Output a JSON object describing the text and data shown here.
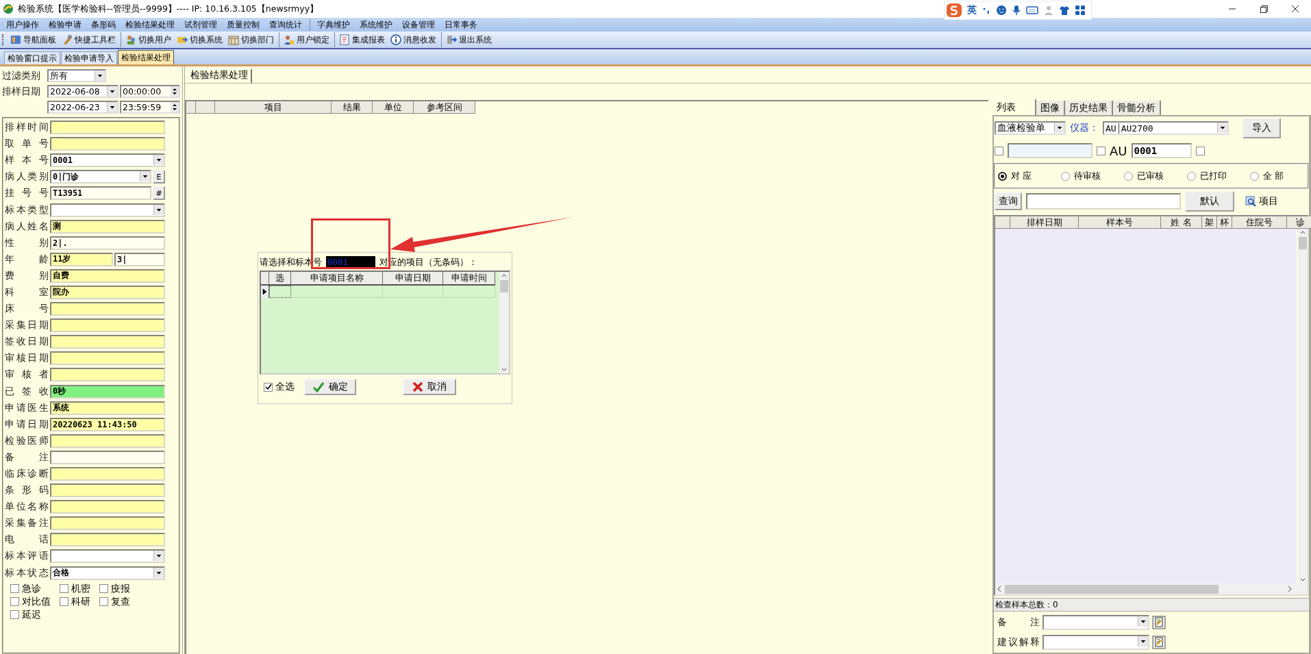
{
  "window": {
    "title": "检验系统【医学检验科--管理员--9999】---- IP: 10.16.3.105【newsrmyy】"
  },
  "ime_toolbar": {
    "mode": "英"
  },
  "menu": [
    {
      "label": "用户操作",
      "separator_before": false
    },
    {
      "label": "检验申请",
      "separator_before": false
    },
    {
      "label": "条形码",
      "separator_before": false
    },
    {
      "label": "检验结果处理",
      "separator_before": false
    },
    {
      "label": "试剂管理",
      "separator_before": false
    },
    {
      "label": "质量控制",
      "separator_before": false
    },
    {
      "label": "查询统计",
      "separator_before": false
    },
    {
      "label": "字典维护",
      "separator_before": true
    },
    {
      "label": "系统维护",
      "separator_before": false
    },
    {
      "label": "设备管理",
      "separator_before": false
    },
    {
      "label": "日常事务",
      "separator_before": false
    }
  ],
  "toolbar": [
    {
      "label": "导航面板",
      "separator_before": false
    },
    {
      "label": "快捷工具栏",
      "separator_before": false
    },
    {
      "label": "切换用户",
      "separator_before": true
    },
    {
      "label": "切换系统",
      "separator_before": false
    },
    {
      "label": "切换部门",
      "separator_before": false
    },
    {
      "label": "用户锁定",
      "separator_before": true
    },
    {
      "label": "集成报表",
      "separator_before": true
    },
    {
      "label": "消息收发",
      "separator_before": false
    },
    {
      "label": "退出系统",
      "separator_before": true
    }
  ],
  "page_tabs": [
    {
      "label": "检验窗口提示",
      "selected": false
    },
    {
      "label": "检验申请导入",
      "selected": false
    },
    {
      "label": "检验结果处理",
      "selected": true
    }
  ],
  "filter": {
    "category_label": "过滤类别",
    "category": "所有",
    "date_label": "排样日期",
    "from_date": "2022-06-08",
    "from_time": "00:00:00",
    "to_date": "2022-06-23",
    "to_time": "23:59:59"
  },
  "form_fields": [
    {
      "label": "排样时间",
      "kind": "text",
      "color": "#ffffa8"
    },
    {
      "label": "取 单 号",
      "kind": "text",
      "color": "#ffffa8"
    },
    {
      "label": "样 本 号",
      "kind": "select",
      "value": "0001",
      "color": "#ffffff"
    },
    {
      "label": "病人类别",
      "kind": "select_button",
      "value": "0|门诊",
      "button": "E",
      "color": "#ffffff"
    },
    {
      "label": "挂 号 号",
      "kind": "text_button",
      "value": "T13951",
      "button": "#",
      "color": "#fffff0"
    },
    {
      "label": "标本类型",
      "kind": "select",
      "color": "#ffffff"
    },
    {
      "label": "病人姓名",
      "kind": "text",
      "value": "测",
      "color": "#ffffa8"
    },
    {
      "label": "性 别",
      "kind": "text",
      "value": "2|.",
      "color": "#fffff0"
    },
    {
      "label": "年 龄",
      "kind": "pair",
      "value": "11岁",
      "value2": "3|",
      "color": "#ffffa8"
    },
    {
      "label": "费 别",
      "kind": "text",
      "value": "自费",
      "color": "#ffffa8"
    },
    {
      "label": "科 室",
      "kind": "text",
      "value": "院办",
      "color": "#ffffa8"
    },
    {
      "label": "床 号",
      "kind": "text",
      "color": "#ffffa8"
    },
    {
      "label": "采集日期",
      "kind": "text",
      "color": "#ffffa8"
    },
    {
      "label": "签收日期",
      "kind": "text",
      "color": "#ffffa8"
    },
    {
      "label": "审核日期",
      "kind": "text",
      "color": "#ffffa8"
    },
    {
      "label": "审 核 者",
      "kind": "text",
      "color": "#ffffa8"
    },
    {
      "label": "已 签 收",
      "kind": "text",
      "value": "0秒",
      "color": "#80f080"
    },
    {
      "label": "申请医生",
      "kind": "text",
      "value": "系统",
      "color": "#ffffa8"
    },
    {
      "label": "申请日期",
      "kind": "text",
      "value": "20220623 11:43:50",
      "color": "#ffffa8"
    },
    {
      "label": "检验医师",
      "kind": "text",
      "color": "#ffffa8"
    },
    {
      "label": "备 注",
      "kind": "text",
      "color": "#fffff0"
    },
    {
      "label": "临床诊断",
      "kind": "text",
      "color": "#ffffa8"
    },
    {
      "label": "条 形 码",
      "kind": "text",
      "color": "#ffffa8"
    },
    {
      "label": "单位名称",
      "kind": "text",
      "color": "#ffffa8"
    },
    {
      "label": "采集备注",
      "kind": "text",
      "color": "#ffffa8"
    },
    {
      "label": "电 话",
      "kind": "text",
      "color": "#ffffa8"
    },
    {
      "label": "标本评语",
      "kind": "select",
      "color": "#ffffff"
    },
    {
      "label": "标本状态",
      "kind": "select",
      "value": "合格",
      "color": "#ffffff"
    }
  ],
  "flags": [
    {
      "label": "急诊",
      "checked": false
    },
    {
      "label": "机密",
      "checked": false
    },
    {
      "label": "疫报",
      "checked": false
    },
    {
      "label": "对比值",
      "checked": false
    },
    {
      "label": "科研",
      "checked": false
    },
    {
      "label": "复查",
      "checked": false
    },
    {
      "label": "延迟",
      "checked": false
    }
  ],
  "center_tab": {
    "label": "检验结果处理"
  },
  "result_grid": {
    "columns": [
      "项目",
      "结果",
      "单位",
      "参考区间"
    ]
  },
  "dialog": {
    "prompt_before": "请选择和标本号",
    "sample_no": "0001",
    "prompt_after": "对应的项目（无条码）：",
    "columns": [
      "选",
      "申请项目名称",
      "申请日期",
      "申请时间"
    ],
    "select_all": {
      "label": "全选",
      "checked": true
    },
    "buttons": [
      {
        "label": "确定",
        "kind": "ok"
      },
      {
        "label": "取消",
        "kind": "cancel"
      }
    ]
  },
  "right_panel": {
    "tabs": [
      {
        "label": "列表",
        "selected": true
      },
      {
        "label": "图像",
        "selected": false
      },
      {
        "label": "历史结果",
        "selected": false
      },
      {
        "label": "骨髓分析",
        "selected": false
      }
    ],
    "sheet_type": "血液检验单",
    "instrument_label": "仪器：",
    "instrument_code": "AU",
    "instrument_name": "AU2700",
    "import_button": "导入",
    "check_a": false,
    "check_b": false,
    "au_label": "AU",
    "sample_no": "0001",
    "check_c": false,
    "radios": [
      {
        "label": "对 应",
        "selected": true
      },
      {
        "label": "待审核",
        "selected": false
      },
      {
        "label": "已审核",
        "selected": false
      },
      {
        "label": "已打印",
        "selected": false
      },
      {
        "label": "全 部",
        "selected": false
      }
    ],
    "query_button": "查询",
    "default_button": "默认",
    "items_link": "项目",
    "columns": [
      "排样日期",
      "样本号",
      "姓 名",
      "架",
      "杯",
      "住院号",
      "诊"
    ],
    "total": "检查样本总数：0",
    "remark_label": "备 注",
    "advice_label": "建议解释"
  }
}
